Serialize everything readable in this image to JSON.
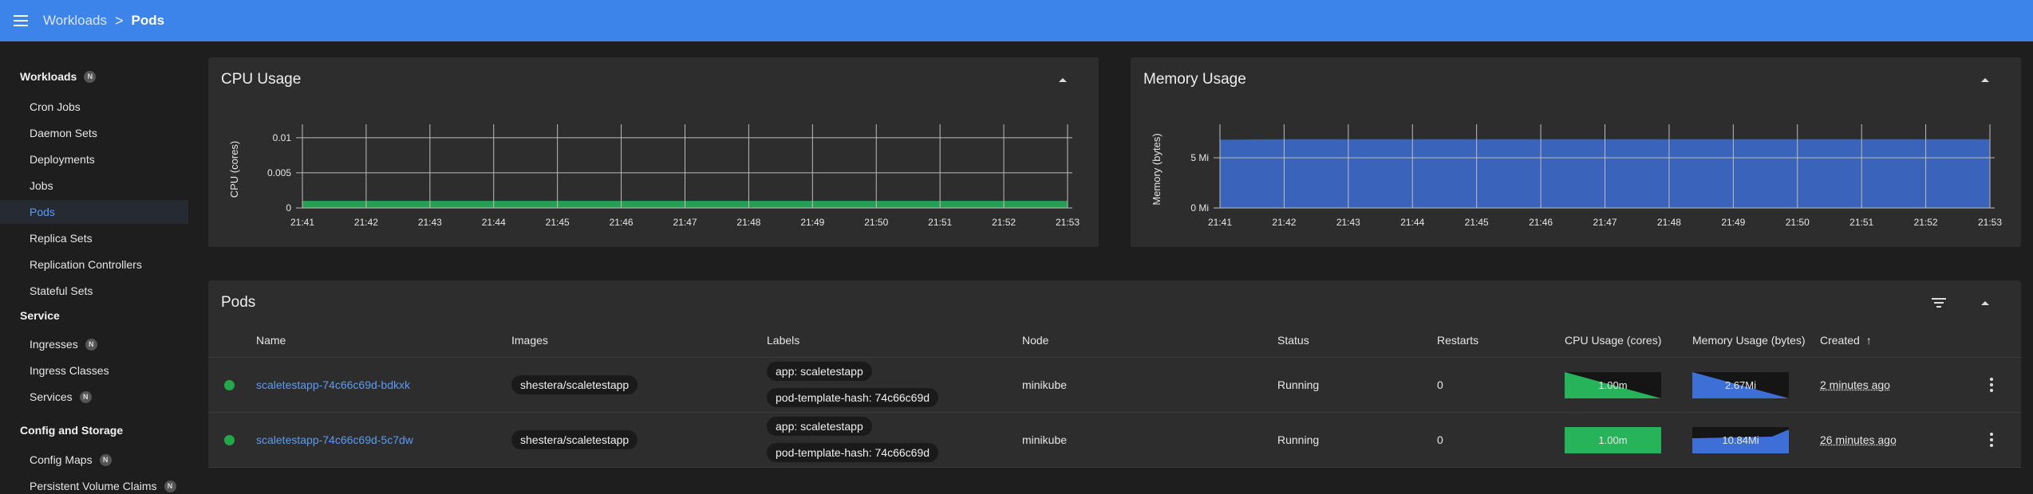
{
  "breadcrumb": {
    "parent": "Workloads",
    "separator": ">",
    "current": "Pods"
  },
  "sidebar": {
    "sections": [
      {
        "title": "Workloads",
        "badge": "N",
        "items": [
          {
            "label": "Cron Jobs"
          },
          {
            "label": "Daemon Sets"
          },
          {
            "label": "Deployments"
          },
          {
            "label": "Jobs"
          },
          {
            "label": "Pods",
            "active": true
          },
          {
            "label": "Replica Sets"
          },
          {
            "label": "Replication Controllers"
          },
          {
            "label": "Stateful Sets"
          }
        ]
      },
      {
        "title": "Service",
        "items": [
          {
            "label": "Ingresses",
            "badge": "N"
          },
          {
            "label": "Ingress Classes"
          },
          {
            "label": "Services",
            "badge": "N"
          }
        ]
      },
      {
        "title": "Config and Storage",
        "items": [
          {
            "label": "Config Maps",
            "badge": "N"
          },
          {
            "label": "Persistent Volume Claims",
            "badge": "N"
          }
        ]
      }
    ]
  },
  "colors": {
    "accent": "#3d84ea",
    "link": "#5b9bf5",
    "cpu_green": "#27b35a",
    "mem_blue": "#3d6fd6",
    "running": "#24a64a"
  },
  "chart_data": [
    {
      "type": "area",
      "title": "CPU Usage",
      "ylabel": "CPU (cores)",
      "xlabel": "",
      "x": [
        "21:41",
        "21:42",
        "21:43",
        "21:44",
        "21:45",
        "21:46",
        "21:47",
        "21:48",
        "21:49",
        "21:50",
        "21:51",
        "21:52",
        "21:53"
      ],
      "yticks": [
        "0",
        "0.005",
        "0.01"
      ],
      "ylim": [
        0,
        0.011
      ],
      "grid": true,
      "series": [
        {
          "values": [
            0.001,
            0.001,
            0.001,
            0.001,
            0.001,
            0.001,
            0.001,
            0.001,
            0.001,
            0.001,
            0.001,
            0.001,
            0.001
          ],
          "color": "#27b35a"
        }
      ]
    },
    {
      "type": "area",
      "title": "Memory Usage",
      "ylabel": "Memory (bytes)",
      "xlabel": "",
      "x": [
        "21:41",
        "21:42",
        "21:43",
        "21:44",
        "21:45",
        "21:46",
        "21:47",
        "21:48",
        "21:49",
        "21:50",
        "21:51",
        "21:52",
        "21:53"
      ],
      "yticks": [
        "0 Mi",
        "5 Mi"
      ],
      "ytick_values": [
        0,
        5
      ],
      "ylim": [
        0,
        7.7
      ],
      "grid": true,
      "series": [
        {
          "values": [
            6.8,
            6.85,
            6.85,
            6.85,
            6.85,
            6.85,
            6.85,
            6.85,
            6.85,
            6.85,
            6.85,
            6.85,
            6.85
          ],
          "color": "#3d6fd6"
        }
      ]
    }
  ],
  "pods": {
    "title": "Pods",
    "columns": [
      "Name",
      "Images",
      "Labels",
      "Node",
      "Status",
      "Restarts",
      "CPU Usage (cores)",
      "Memory Usage (bytes)",
      "Created"
    ],
    "sort_indicator": "↑",
    "rows": [
      {
        "name": "scaletestapp-74c66c69d-bdkxk",
        "image": "shestera/scaletestapp",
        "labels": [
          "app: scaletestapp",
          "pod-template-hash: 74c66c69d"
        ],
        "node": "minikube",
        "status": "Running",
        "restarts": "0",
        "cpu": "1.00m",
        "cpu_trend": "down",
        "mem": "2.67Mi",
        "mem_trend": "down",
        "created": "2 minutes ago"
      },
      {
        "name": "scaletestapp-74c66c69d-5c7dw",
        "image": "shestera/scaletestapp",
        "labels": [
          "app: scaletestapp",
          "pod-template-hash: 74c66c69d"
        ],
        "node": "minikube",
        "status": "Running",
        "restarts": "0",
        "cpu": "1.00m",
        "cpu_trend": "flat",
        "mem": "10.84Mi",
        "mem_trend": "up",
        "created": "26 minutes ago"
      }
    ]
  }
}
